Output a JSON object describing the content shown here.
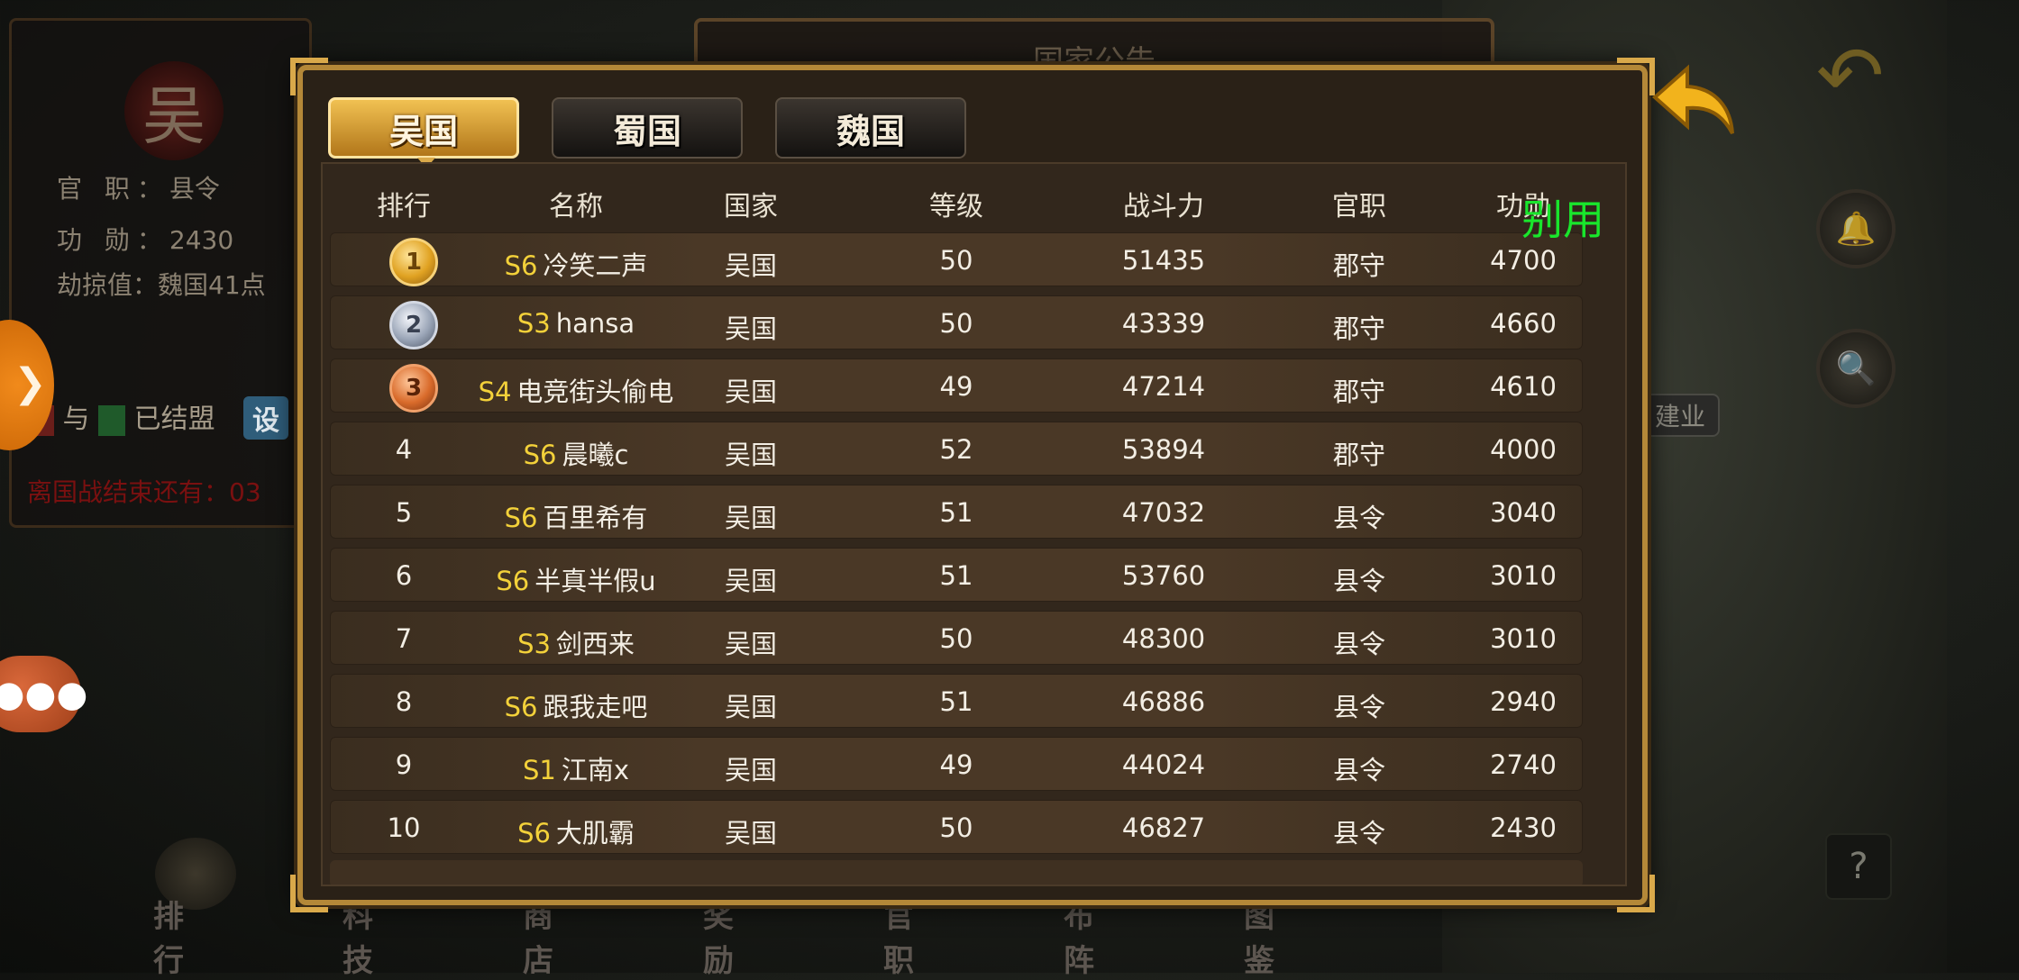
{
  "background": {
    "emblem": "吴",
    "info": [
      {
        "label": "官 职：",
        "value": "县令"
      },
      {
        "label": "功 勋：",
        "value": "2430"
      },
      {
        "label": "劫掠值：",
        "value": "魏国41点"
      }
    ],
    "alliance_text": "与",
    "alliance_status": "已结盟",
    "settings_tag": "设",
    "countdown": "离国战结束还有：03",
    "announcement": "国家公告",
    "bottom_nav": [
      "排行",
      "科技",
      "商店",
      "奖励",
      "官职",
      "布阵",
      "图鉴"
    ],
    "city_label": "建业",
    "help": "?"
  },
  "tabs": [
    {
      "label": "吴国",
      "active": true
    },
    {
      "label": "蜀国",
      "active": false
    },
    {
      "label": "魏国",
      "active": false
    }
  ],
  "columns": [
    "排行",
    "名称",
    "国家",
    "等级",
    "战斗力",
    "官职",
    "功勋"
  ],
  "rows": [
    {
      "rank": "1",
      "medal": "gold",
      "server": "S6",
      "name": "冷笑二声",
      "country": "吴国",
      "level": "50",
      "power": "51435",
      "office": "郡守",
      "merit": "4700"
    },
    {
      "rank": "2",
      "medal": "silver",
      "server": "S3",
      "name": "hansa",
      "country": "吴国",
      "level": "50",
      "power": "43339",
      "office": "郡守",
      "merit": "4660"
    },
    {
      "rank": "3",
      "medal": "bronze",
      "server": "S4",
      "name": "电竞街头偷电",
      "country": "吴国",
      "level": "49",
      "power": "47214",
      "office": "郡守",
      "merit": "4610"
    },
    {
      "rank": "4",
      "medal": "",
      "server": "S6",
      "name": "晨曦c",
      "country": "吴国",
      "level": "52",
      "power": "53894",
      "office": "郡守",
      "merit": "4000"
    },
    {
      "rank": "5",
      "medal": "",
      "server": "S6",
      "name": "百里希有",
      "country": "吴国",
      "level": "51",
      "power": "47032",
      "office": "县令",
      "merit": "3040"
    },
    {
      "rank": "6",
      "medal": "",
      "server": "S6",
      "name": "半真半假u",
      "country": "吴国",
      "level": "51",
      "power": "53760",
      "office": "县令",
      "merit": "3010"
    },
    {
      "rank": "7",
      "medal": "",
      "server": "S3",
      "name": "剑西来",
      "country": "吴国",
      "level": "50",
      "power": "48300",
      "office": "县令",
      "merit": "3010"
    },
    {
      "rank": "8",
      "medal": "",
      "server": "S6",
      "name": "跟我走吧",
      "country": "吴国",
      "level": "51",
      "power": "46886",
      "office": "县令",
      "merit": "2940"
    },
    {
      "rank": "9",
      "medal": "",
      "server": "S1",
      "name": "江南x",
      "country": "吴国",
      "level": "49",
      "power": "44024",
      "office": "县令",
      "merit": "2740"
    },
    {
      "rank": "10",
      "medal": "",
      "server": "S6",
      "name": "大肌霸",
      "country": "吴国",
      "level": "50",
      "power": "46827",
      "office": "县令",
      "merit": "2430"
    }
  ],
  "overlay_label": "别用",
  "colors": {
    "accent_gold": "#d9a94a",
    "server_yellow": "#f3d13a",
    "overlay_green": "#19e62c"
  }
}
